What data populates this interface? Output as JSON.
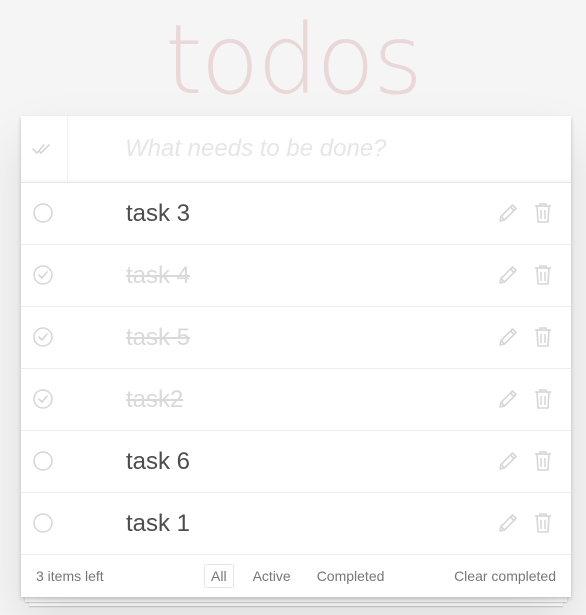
{
  "app": {
    "title": "todos"
  },
  "new_todo": {
    "placeholder": "What needs to be done?",
    "value": ""
  },
  "todos": [
    {
      "label": "task 3",
      "completed": false
    },
    {
      "label": "task 4",
      "completed": true
    },
    {
      "label": "task 5",
      "completed": true
    },
    {
      "label": "task2",
      "completed": true
    },
    {
      "label": "task 6",
      "completed": false
    },
    {
      "label": "task 1",
      "completed": false
    }
  ],
  "footer": {
    "items_left": "3 items left",
    "filters": [
      "All",
      "Active",
      "Completed"
    ],
    "selected_filter": "All",
    "clear_completed": "Clear completed"
  },
  "icons": {
    "toggle_all": "double-check-icon",
    "unchecked": "circle-icon",
    "checked": "check-circle-icon",
    "edit": "pencil-icon",
    "delete": "trash-icon"
  },
  "colors": {
    "title": "#f1dede",
    "background": "#f5f5f5",
    "icon": "#d6d6d6",
    "completed_text": "#d9d9d9",
    "text": "#4d4d4d"
  }
}
